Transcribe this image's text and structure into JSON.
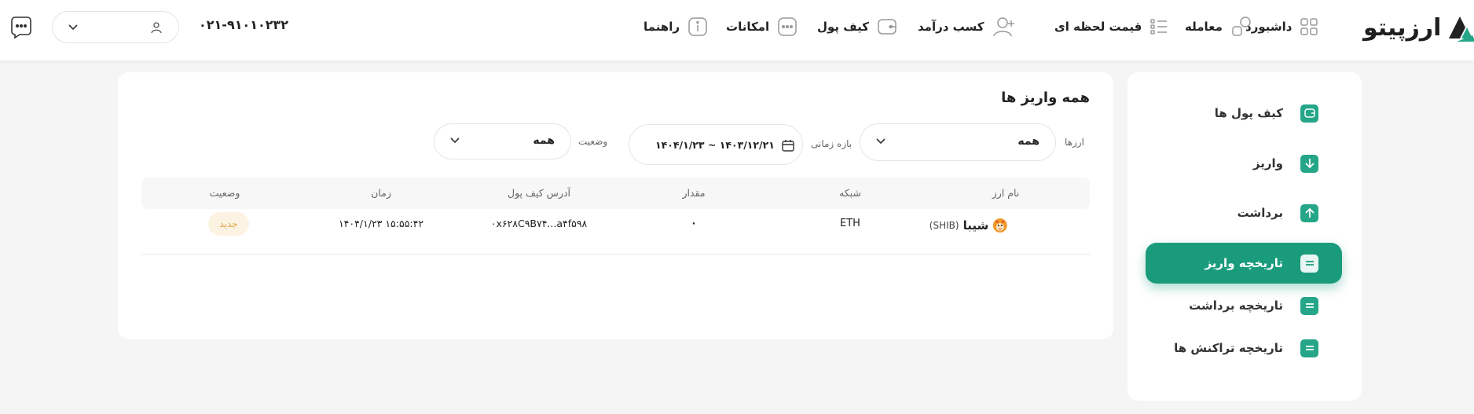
{
  "header": {
    "logo_text": "ارزپیتو",
    "nav": [
      {
        "label": "داشبورد",
        "icon": "dashboard-grid-icon"
      },
      {
        "label": "معامله",
        "icon": "trade-icon"
      },
      {
        "label": "قیمت لحظه ای",
        "icon": "price-list-icon"
      },
      {
        "label": "کسب درآمد",
        "icon": "add-user-icon"
      },
      {
        "label": "کیف پول",
        "icon": "wallet-icon"
      },
      {
        "label": "امکانات",
        "icon": "more-dots-icon"
      },
      {
        "label": "راهنما",
        "icon": "info-icon"
      }
    ],
    "phone": "۰۲۱-۹۱۰۱۰۲۳۲"
  },
  "sidebar": {
    "items": [
      {
        "label": "کیف پول ها",
        "icon": "wallet-icon",
        "active": false
      },
      {
        "label": "واریز",
        "icon": "arrow-down-icon",
        "active": false
      },
      {
        "label": "برداشت",
        "icon": "arrow-up-icon",
        "active": false
      },
      {
        "label": "تاریخچه واریز",
        "icon": "history-icon",
        "active": true
      },
      {
        "label": "تاریخچه برداشت",
        "icon": "history-icon",
        "active": false
      },
      {
        "label": "تاریخچه تراکنش ها",
        "icon": "history-icon",
        "active": false
      }
    ]
  },
  "main": {
    "title": "همه واریز ها",
    "filters": {
      "currency_label": "ارزها",
      "currency_value": "همه",
      "date_label": "بازه زمانی",
      "date_value": "۱۴۰۴/۱/۲۳ ~ ۱۴۰۳/۱۲/۲۱",
      "status_label": "وضعیت",
      "status_value": "همه"
    },
    "table": {
      "headers": [
        "نام ارز",
        "شبکه",
        "مقدار",
        "آدرس کیف پول",
        "زمان",
        "وضعیت"
      ],
      "rows": [
        {
          "currency_name": "شیبا",
          "currency_symbol": "(SHIB)",
          "network": "ETH",
          "amount": "۰",
          "address": "۰x۶۲۸C۹B۷۴...a۴f۵۹۸",
          "time": "۱۴۰۴/۱/۲۳ ۱۵:۵۵:۴۲",
          "status": "جدید"
        }
      ]
    }
  },
  "colors": {
    "accent": "#1a9c7c",
    "badge_bg": "#fdf3e3",
    "badge_text": "#e1a548"
  }
}
